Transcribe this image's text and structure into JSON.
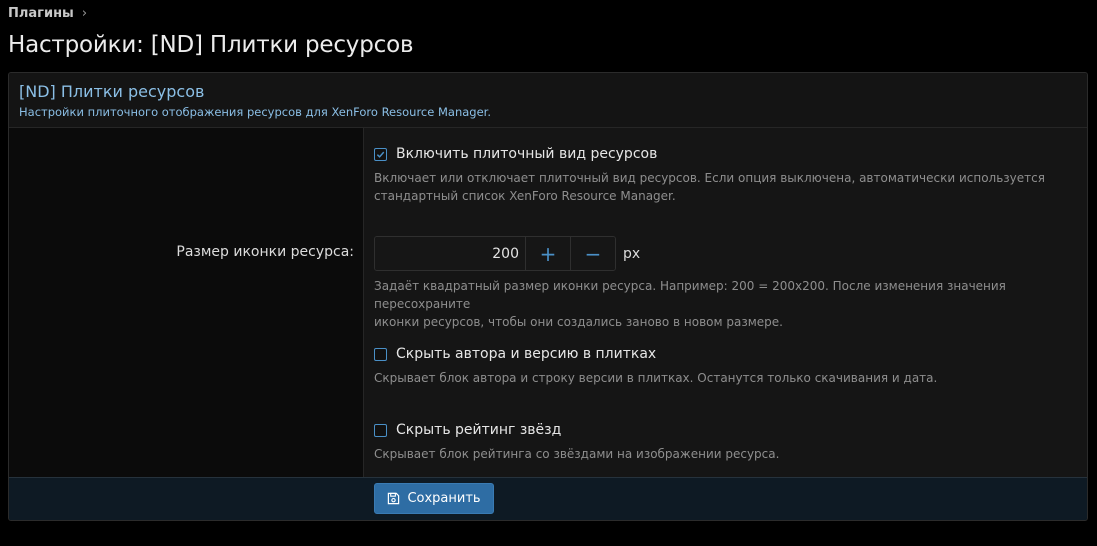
{
  "breadcrumb": {
    "root": "Плагины"
  },
  "page_title": "Настройки: [ND] Плитки ресурсов",
  "block": {
    "title": "[ND] Плитки ресурсов",
    "description": "Настройки плиточного отображения ресурсов для XenForo Resource Manager."
  },
  "options": {
    "enable_grid": {
      "label": "Включить плиточный вид ресурсов",
      "checked": true,
      "hint_line1": "Включает или отключает плиточный вид ресурсов. Если опция выключена, автоматически используется",
      "hint_line2": "стандартный список XenForo Resource Manager."
    },
    "icon_size": {
      "row_label": "Размер иконки ресурса:",
      "value": "200",
      "plus": "+",
      "minus": "−",
      "units": "px",
      "hint_line1": "Задаёт квадратный размер иконки ресурса. Например: 200 = 200x200. После изменения значения пересохраните",
      "hint_line2": "иконки ресурсов, чтобы они создались заново в новом размере."
    },
    "hide_author": {
      "label": "Скрыть автора и версию в плитках",
      "checked": false,
      "hint": "Скрывает блок автора и строку версии в плитках. Останутся только скачивания и дата."
    },
    "hide_rating": {
      "label": "Скрыть рейтинг звёзд",
      "checked": false,
      "hint": "Скрывает блок рейтинга со звёздами на изображении ресурса."
    }
  },
  "footer": {
    "save_label": "Сохранить"
  },
  "colors": {
    "accent": "#4a90c7",
    "button": "#2e6da4",
    "link": "#8bbfe6"
  }
}
